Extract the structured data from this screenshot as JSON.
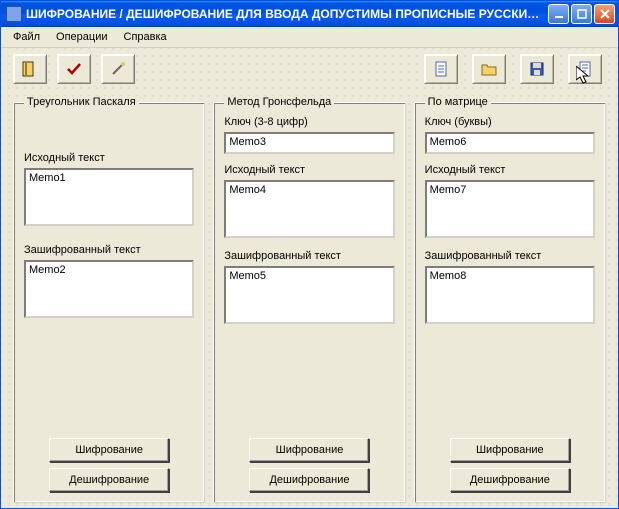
{
  "window": {
    "title": "ШИФРОВАНИЕ / ДЕШИФРОВАНИЕ    ДЛЯ ВВОДА ДОПУСТИМЫ ПРОПИСНЫЕ РУССКИЕ …"
  },
  "menu": {
    "file": "Файл",
    "ops": "Операции",
    "help": "Справка"
  },
  "icons": {
    "exit": "exit-icon",
    "check": "check-icon",
    "wizard": "wizard-icon",
    "doc1": "document-icon",
    "open": "open-folder-icon",
    "save": "floppy-icon",
    "doc2": "report-icon"
  },
  "panels": {
    "pascal": {
      "legend": "Треугольник Паскаля",
      "source_label": "Исходный текст",
      "source_text": "Memo1",
      "cipher_label": "Зашифрованный текст",
      "cipher_text": "Memo2",
      "encrypt_btn": "Шифрование",
      "decrypt_btn": "Дешифрование"
    },
    "gronsfeld": {
      "legend": "Метод Гронсфельда",
      "key_label": "Ключ (3-8 цифр)",
      "key_text": "Memo3",
      "source_label": "Исходный текст",
      "source_text": "Memo4",
      "cipher_label": "Зашифрованный текст",
      "cipher_text": "Memo5",
      "encrypt_btn": "Шифрование",
      "decrypt_btn": "Дешифрование"
    },
    "matrix": {
      "legend": "По матрице",
      "key_label": "Ключ (буквы)",
      "key_text": "Memo6",
      "source_label": "Исходный текст",
      "source_text": "Memo7",
      "cipher_label": "Зашифрованный текст",
      "cipher_text": "Memo8",
      "encrypt_btn": "Шифрование",
      "decrypt_btn": "Дешифрование"
    }
  }
}
